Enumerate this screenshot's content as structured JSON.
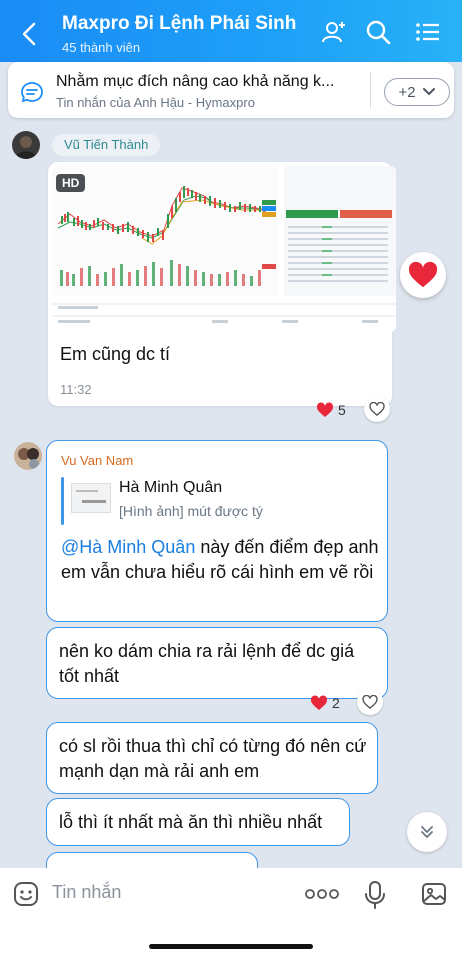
{
  "header": {
    "title": "Maxpro Đi Lệnh Phái Sinh",
    "subtitle": "45 thành viên",
    "icons": [
      "back-arrow",
      "add-member-icon",
      "search-icon",
      "menu-list-icon"
    ]
  },
  "pinned": {
    "title": "Nhằm mục đích nâng cao khả năng k...",
    "subtitle": "Tin nhắn của Anh Hậu - Hymaxpro",
    "more_label": "+2"
  },
  "message1": {
    "sender": "Vũ Tiến Thành",
    "image_badge": "HD",
    "text": "Em cũng dc tí",
    "time": "11:32",
    "reaction_count": "5"
  },
  "message2": {
    "sender": "Vu Van Nam",
    "quote_name": "Hà Minh Quân",
    "quote_text": "[Hình ảnh] mút được tý",
    "mention": "@Hà Minh Quân",
    "text_rest": " này đến điểm đẹp anh em vẫn chưa hiểu rõ cái hình em vẽ rồi"
  },
  "message3": {
    "text": "nên ko dám chia ra rải lệnh để dc giá tốt nhất",
    "reaction_count": "2"
  },
  "message4": {
    "text": "có sl rồi thua thì chỉ có từng đó nên cứ mạnh dạn mà rải anh em"
  },
  "message5": {
    "text": "lỗ thì ít nhất mà ăn thì nhiều nhất"
  },
  "input": {
    "placeholder": "Tin nhắn",
    "icons": [
      "sticker-icon",
      "more-dots-icon",
      "microphone-icon",
      "image-icon"
    ]
  },
  "colors": {
    "header_gradient_start": "#1a8cf6",
    "header_gradient_end": "#28b2f6",
    "bubble_border": "#3f96e6",
    "sender_orange": "#d86a1f",
    "heart_red": "#e8273a"
  }
}
